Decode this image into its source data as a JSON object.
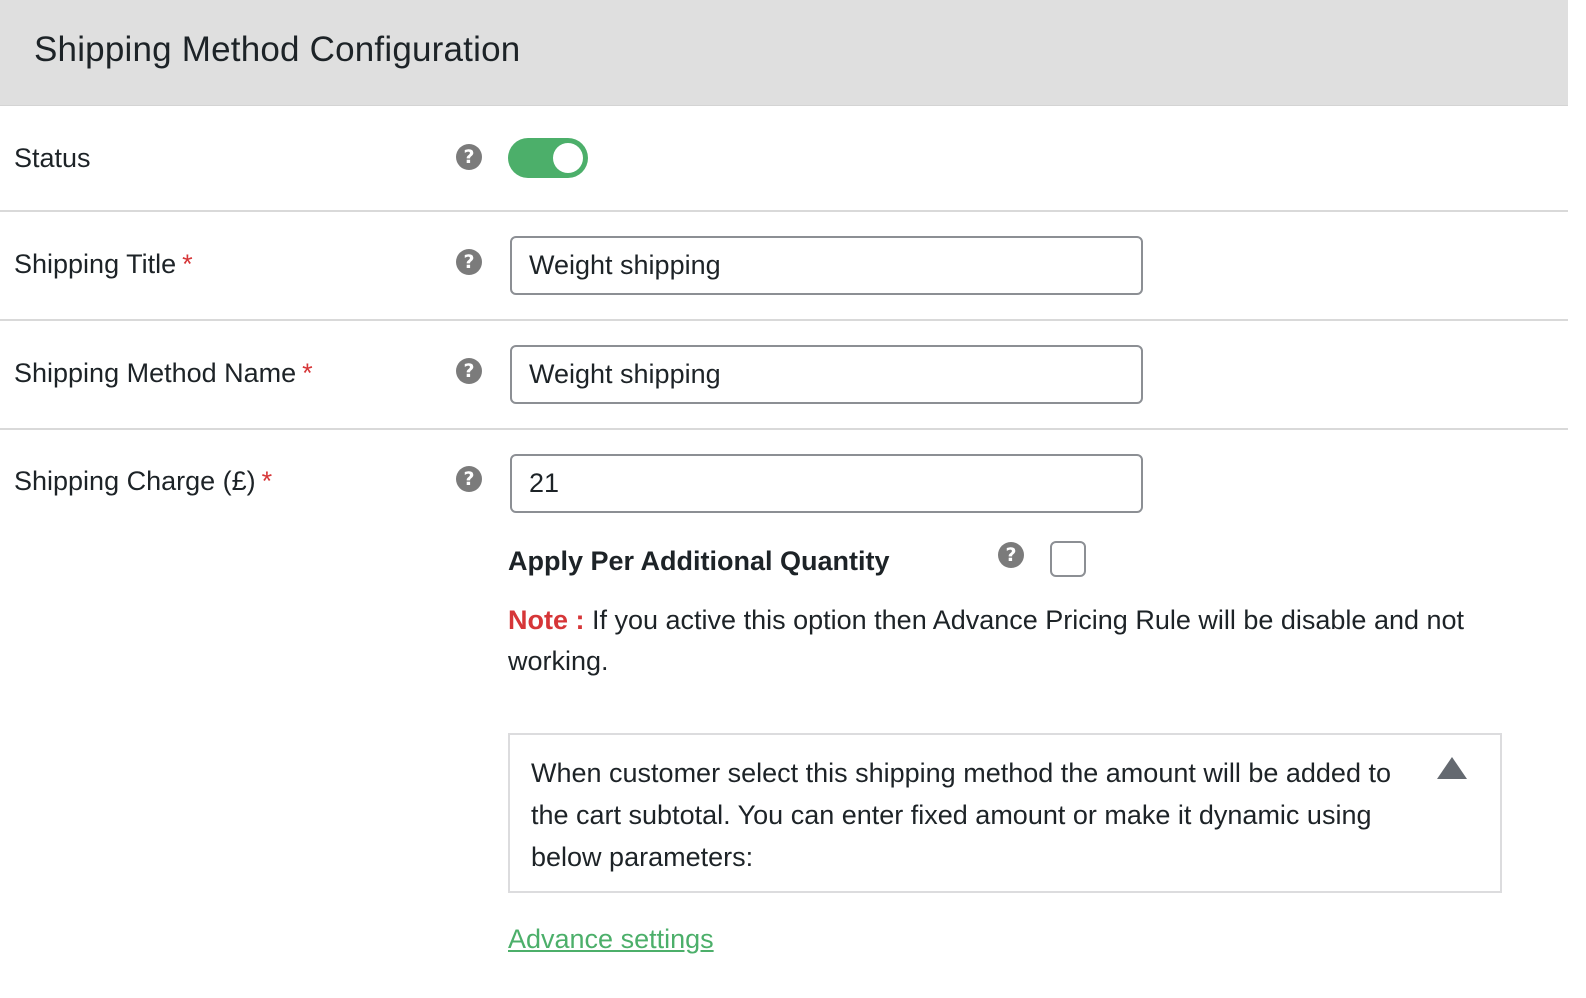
{
  "header": {
    "title": "Shipping Method Configuration"
  },
  "rows": {
    "status": {
      "label": "Status",
      "enabled": true
    },
    "shipping_title": {
      "label": "Shipping Title",
      "required_mark": "*",
      "value": "Weight shipping"
    },
    "method_name": {
      "label": "Shipping Method Name",
      "required_mark": "*",
      "value": "Weight shipping"
    },
    "charge": {
      "label": "Shipping Charge (£)",
      "required_mark": "*",
      "value": "21",
      "apply_per_qty_label": "Apply Per Additional Quantity",
      "apply_per_qty_checked": false,
      "note_label": "Note :",
      "note_text": " If you active this option then Advance Pricing Rule will be disable and not working.",
      "description": "When customer select this shipping method the amount will be added to the cart subtotal. You can enter fixed amount or make it dynamic using below parameters:",
      "advance_link": "Advance settings"
    }
  },
  "help_glyph": "?",
  "colors": {
    "accent_green": "#4caf6a",
    "required_red": "#d63638"
  }
}
